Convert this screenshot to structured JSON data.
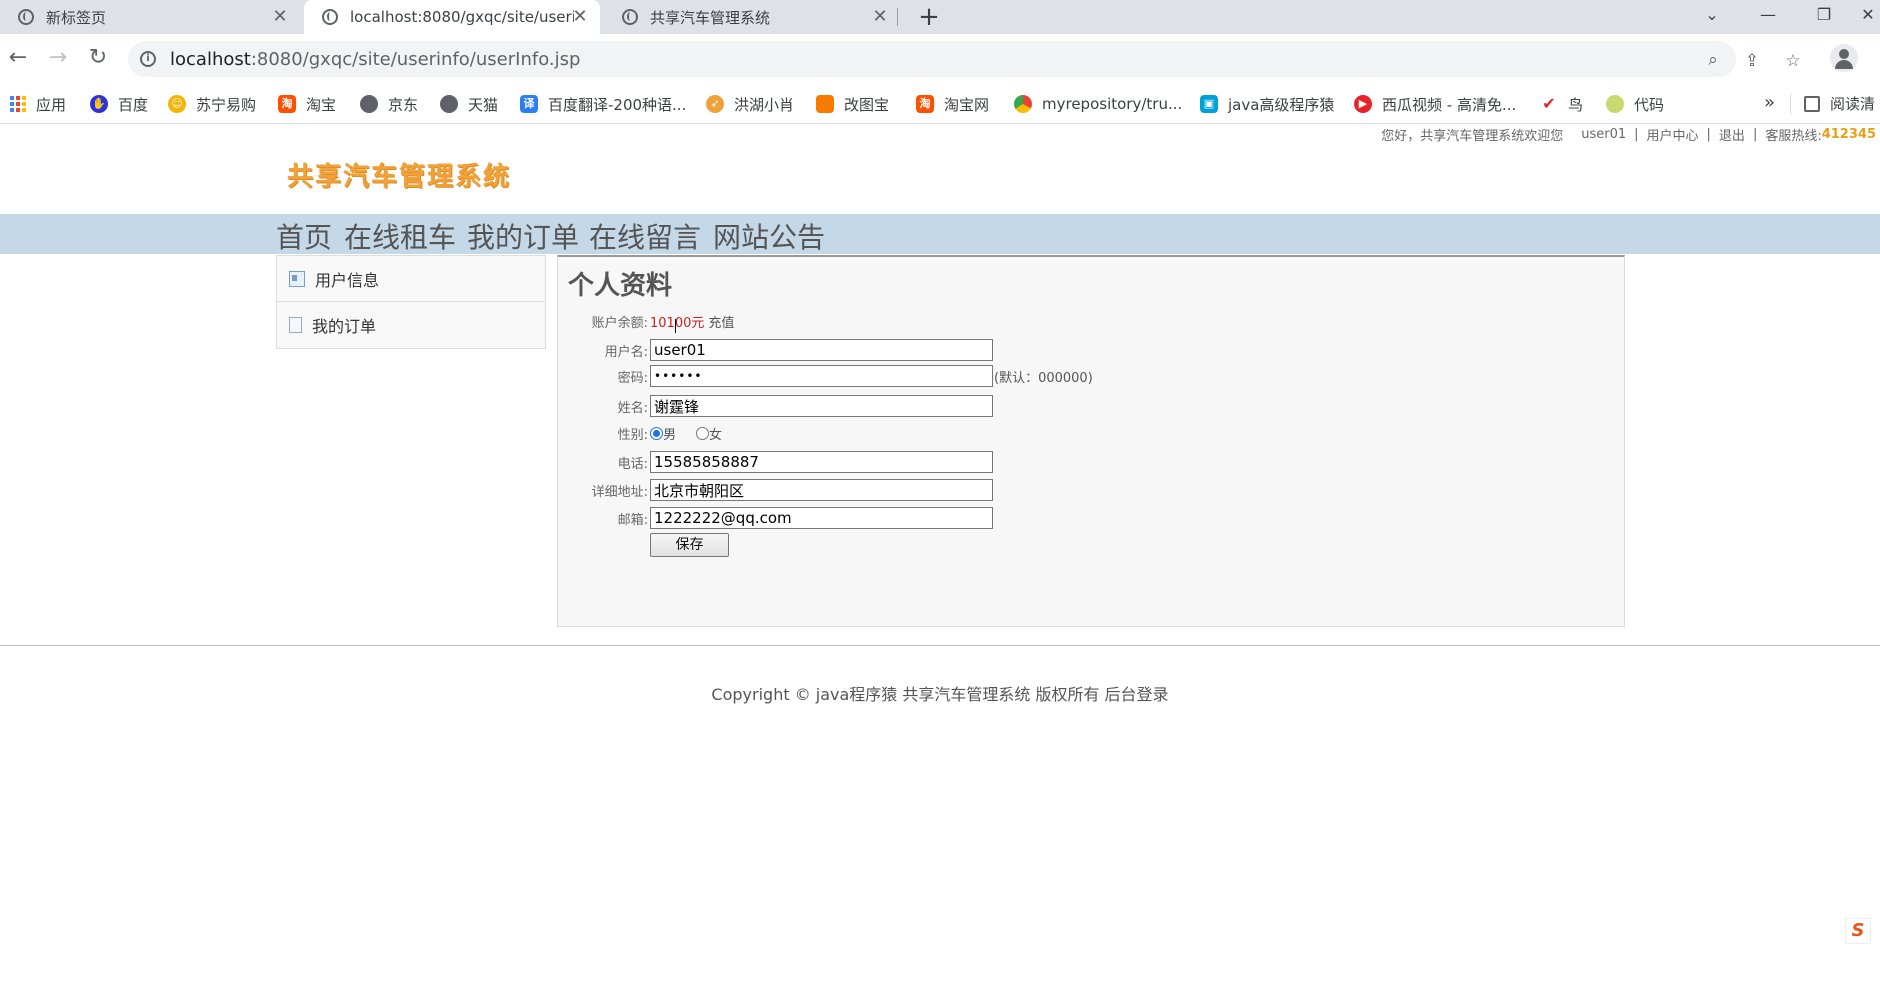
{
  "browser": {
    "tabs": [
      {
        "title": "新标签页",
        "active": false
      },
      {
        "title": "localhost:8080/gxqc/site/userinfo/userInfo.jsp",
        "active": true
      },
      {
        "title": "共享汽车管理系统",
        "active": false
      }
    ],
    "url_host": "localhost",
    "url_rest": ":8080/gxqc/site/userinfo/userInfo.jsp",
    "bookmarks": [
      {
        "label": "应用",
        "icon": "apps-grid-icon"
      },
      {
        "label": "百度",
        "icon": "baidu-icon",
        "color": "#2932e1"
      },
      {
        "label": "苏宁易购",
        "icon": "suning-icon",
        "color": "#f5b400"
      },
      {
        "label": "淘宝",
        "icon": "taobao-icon",
        "color": "#ff5000"
      },
      {
        "label": "京东",
        "icon": "globe-icon",
        "color": "#5f6368"
      },
      {
        "label": "天猫",
        "icon": "globe-icon",
        "color": "#5f6368"
      },
      {
        "label": "百度翻译-200种语...",
        "icon": "translate-icon",
        "color": "#2b7ef5"
      },
      {
        "label": "洪湖小肖",
        "icon": "rocket-icon",
        "color": "#f0a23a"
      },
      {
        "label": "改图宝",
        "icon": "gaitubao-icon",
        "color": "#f57c00"
      },
      {
        "label": "淘宝网",
        "icon": "taobao-icon",
        "color": "#ff5000"
      },
      {
        "label": "myrepository/tru...",
        "icon": "chrome-icon",
        "color": "#34a853"
      },
      {
        "label": "java高级程序猿",
        "icon": "bilibili-icon",
        "color": "#00a1d6"
      },
      {
        "label": "西瓜视频 - 高清免...",
        "icon": "xigua-icon",
        "color": "#e8232a"
      },
      {
        "label": "鸟",
        "icon": "bird-icon",
        "color": "#e8232a"
      },
      {
        "label": "代码",
        "icon": "leaf-icon",
        "color": "#c8d96f"
      }
    ],
    "reading_list": "阅读清"
  },
  "page": {
    "topbar": {
      "welcome": "您好，共享汽车管理系统欢迎您",
      "username": "user01",
      "user_center": "用户中心",
      "logout": "退出",
      "hotline_label": "客服热线:",
      "hotline_number": "412345"
    },
    "logo": "共享汽车管理系统",
    "nav": [
      "首页",
      "在线租车",
      "我的订单",
      "在线留言",
      "网站公告"
    ],
    "sidebar": [
      {
        "label": "用户信息"
      },
      {
        "label": "我的订单"
      }
    ],
    "profile": {
      "title": "个人资料",
      "balance_label": "账户余额:",
      "balance_value": "10100元",
      "recharge": "充值",
      "username_label": "用户名:",
      "username_value": "user01",
      "password_label": "密码:",
      "password_value": "••••••",
      "password_hint": "(默认：000000)",
      "name_label": "姓名:",
      "name_value": "谢霆锋",
      "gender_label": "性别:",
      "gender_options": [
        "男",
        "女"
      ],
      "gender_selected": "男",
      "phone_label": "电话:",
      "phone_value": "15585858887",
      "address_label": "详细地址:",
      "address_value": "北京市朝阳区",
      "email_label": "邮箱:",
      "email_value": "1222222@qq.com",
      "save_label": "保存"
    },
    "footer": "Copyright © java程序猿 共享汽车管理系统 版权所有 后台登录"
  }
}
